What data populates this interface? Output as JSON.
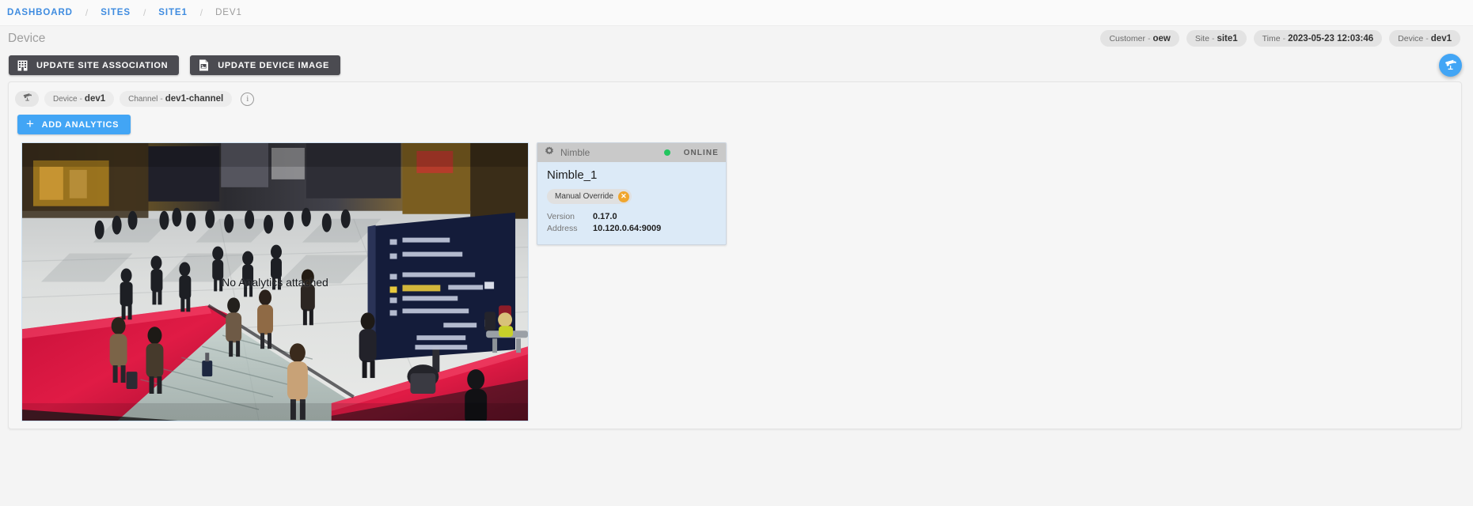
{
  "breadcrumb": {
    "items": [
      {
        "label": "DASHBOARD",
        "current": false
      },
      {
        "label": "SITES",
        "current": false
      },
      {
        "label": "SITE1",
        "current": false
      },
      {
        "label": "DEV1",
        "current": true
      }
    ],
    "separator": "/"
  },
  "header": {
    "page_title": "Device",
    "chips": [
      {
        "key": "Customer",
        "dash": "-",
        "value": "oew"
      },
      {
        "key": "Site",
        "dash": "-",
        "value": "site1"
      },
      {
        "key": "Time",
        "dash": "-",
        "value": "2023-05-23 12:03:46"
      },
      {
        "key": "Device",
        "dash": "-",
        "value": "dev1"
      }
    ],
    "fab": {
      "icon": "cctv-camera-icon",
      "color": "#42a5f5"
    }
  },
  "actions": {
    "update_site_association": {
      "label": "UPDATE SITE ASSOCIATION",
      "icon": "building-icon"
    },
    "update_device_image": {
      "label": "UPDATE DEVICE IMAGE",
      "icon": "image-file-icon"
    }
  },
  "panel": {
    "device_chips": {
      "camera_icon": "cctv-camera-icon",
      "device": {
        "key": "Device",
        "dash": "-",
        "value": "dev1"
      },
      "channel": {
        "key": "Channel",
        "dash": "-",
        "value": "dev1-channel"
      },
      "info_glyph": "i"
    },
    "add_analytics": {
      "label": "ADD ANALYTICS",
      "plus": "+"
    },
    "video": {
      "overlay_text": "No Analytics attached",
      "alt": "train-station-concourse-snapshot"
    },
    "nimble_card": {
      "header": {
        "icon": "gear-icon",
        "name": "Nimble",
        "status": "ONLINE",
        "status_color": "#22c55e"
      },
      "title": "Nimble_1",
      "override_chip": {
        "label": "Manual Override",
        "remove_glyph": "✕",
        "badge_color": "#f0a62e"
      },
      "fields": [
        {
          "key": "Version",
          "value": "0.17.0"
        },
        {
          "key": "Address",
          "value": "10.120.0.64:9009"
        }
      ]
    }
  },
  "colors": {
    "accent_blue": "#42a5f5",
    "link_blue": "#3f8ce0",
    "dark_button": "#4b4b51",
    "card_body": "#dceaf7",
    "card_header": "#c9c9c9",
    "online_green": "#22c55e",
    "warning_orange": "#f0a62e"
  }
}
